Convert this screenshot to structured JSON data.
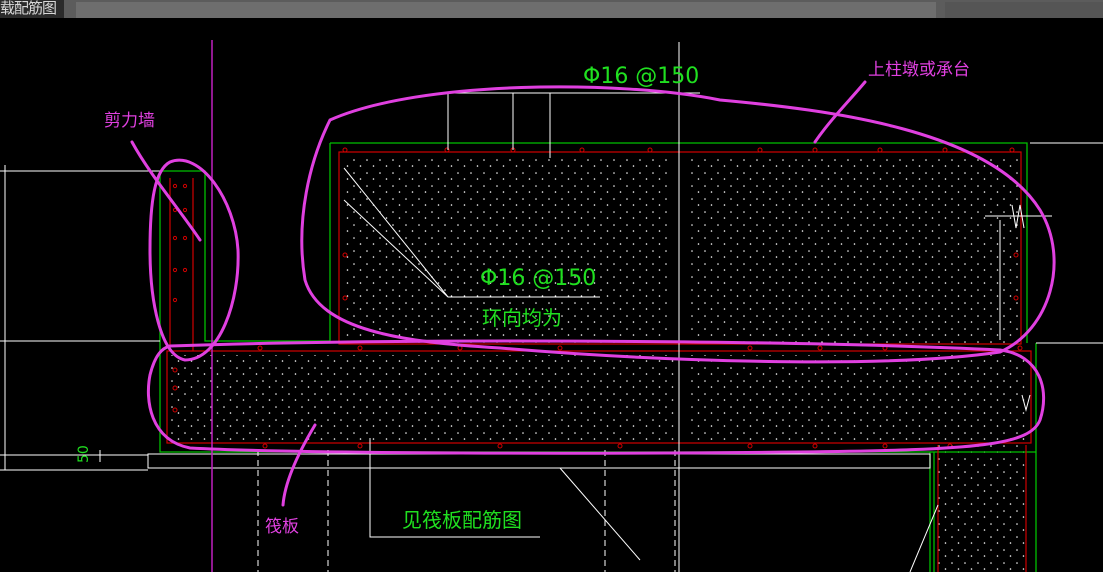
{
  "window": {
    "title_partial": "载配筋图"
  },
  "drawing": {
    "rebar_top": "Φ16 @150",
    "rebar_side": "Φ16 @150",
    "ring_note": "环向均为",
    "raft_note": "见筏板配筋图",
    "dim_50": "50"
  },
  "annotations": {
    "shear_wall": "剪力墙",
    "pier_cap": "上柱墩或承台",
    "raft": "筏板"
  },
  "colors": {
    "background": "#000000",
    "outline_green": "#00c000",
    "rebar_red": "#d00000",
    "annotation_magenta": "#e040e0",
    "label_green": "#20e020",
    "line_white": "#ffffff"
  }
}
